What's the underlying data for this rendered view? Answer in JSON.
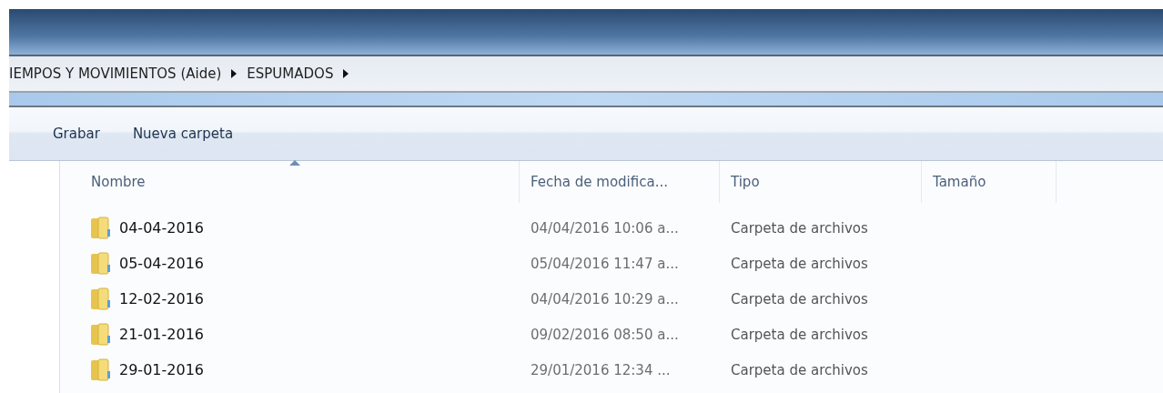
{
  "breadcrumb": [
    {
      "label": "IEMPOS Y MOVIMIENTOS (Aide)"
    },
    {
      "label": "ESPUMADOS"
    }
  ],
  "toolbar": [
    "Grabar",
    "Nueva carpeta"
  ],
  "columns": [
    {
      "label": "Nombre",
      "sorted": true
    },
    {
      "label": "Fecha de modifica...",
      "sorted": false
    },
    {
      "label": "Tipo",
      "sorted": false
    },
    {
      "label": "Tamaño",
      "sorted": false
    }
  ],
  "rows": [
    {
      "name": "04-04-2016",
      "modified": "04/04/2016 10:06 a...",
      "type": "Carpeta de archivos"
    },
    {
      "name": "05-04-2016",
      "modified": "05/04/2016 11:47 a...",
      "type": "Carpeta de archivos"
    },
    {
      "name": "12-02-2016",
      "modified": "04/04/2016 10:29 a...",
      "type": "Carpeta de archivos"
    },
    {
      "name": "21-01-2016",
      "modified": "09/02/2016 08:50 a...",
      "type": "Carpeta de archivos"
    },
    {
      "name": "29-01-2016",
      "modified": "29/01/2016 12:34 ...",
      "type": "Carpeta de archivos"
    }
  ]
}
